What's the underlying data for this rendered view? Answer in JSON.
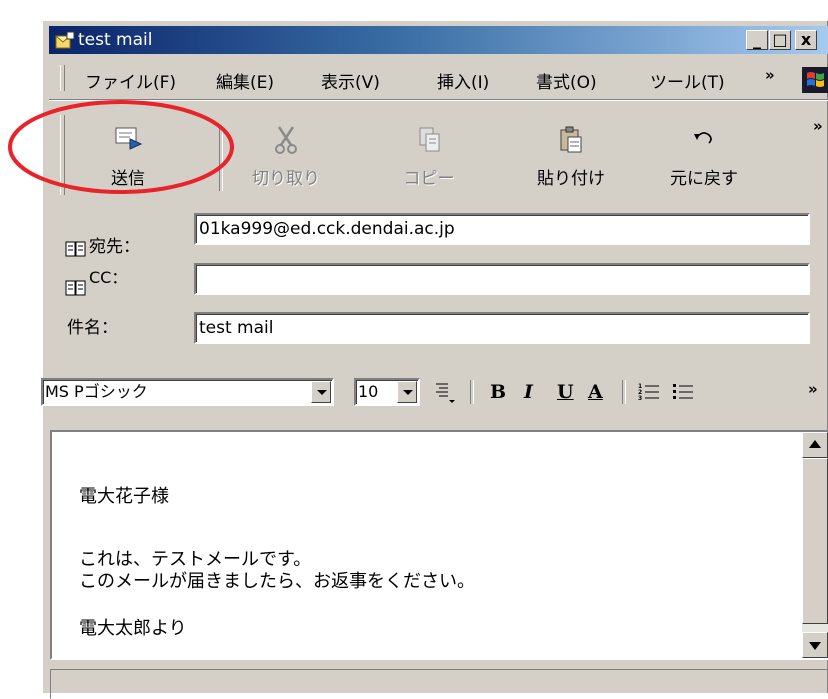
{
  "window": {
    "title": "test mail",
    "controls": {
      "minimize": "_",
      "maximize": "□",
      "close": "x"
    }
  },
  "menubar": {
    "items": [
      "ファイル(F)",
      "編集(E)",
      "表示(V)",
      "挿入(I)",
      "書式(O)",
      "ツール(T)"
    ],
    "overflow": "»"
  },
  "toolbar": {
    "buttons": [
      {
        "label": "送信",
        "icon": "send-icon",
        "enabled": true
      },
      {
        "label": "切り取り",
        "icon": "scissors-icon",
        "enabled": false
      },
      {
        "label": "コピー",
        "icon": "copy-icon",
        "enabled": false
      },
      {
        "label": "貼り付け",
        "icon": "paste-icon",
        "enabled": true
      },
      {
        "label": "元に戻す",
        "icon": "undo-icon",
        "enabled": true
      }
    ],
    "overflow": "»"
  },
  "header": {
    "to_label": "宛先：",
    "to_value": "01ka999@ed.cck.dendai.ac.jp",
    "cc_label": "CC：",
    "cc_value": "",
    "subject_label": "件名：",
    "subject_value": "test mail"
  },
  "format": {
    "font": "MS Pゴシック",
    "size": "10",
    "bold": "B",
    "italic": "I",
    "underline": "U",
    "color": "A",
    "overflow": "»"
  },
  "body": {
    "lines": [
      "電大花子様",
      "",
      "これは、テストメールです。",
      "このメールが届きましたら、お返事をください。",
      "",
      "電大太郎より"
    ]
  },
  "annotation": {
    "highlight_color": "#e8232a"
  },
  "colors": {
    "face": "#d4d0c8",
    "title_start": "#0a246a",
    "title_end": "#a6caf0"
  }
}
